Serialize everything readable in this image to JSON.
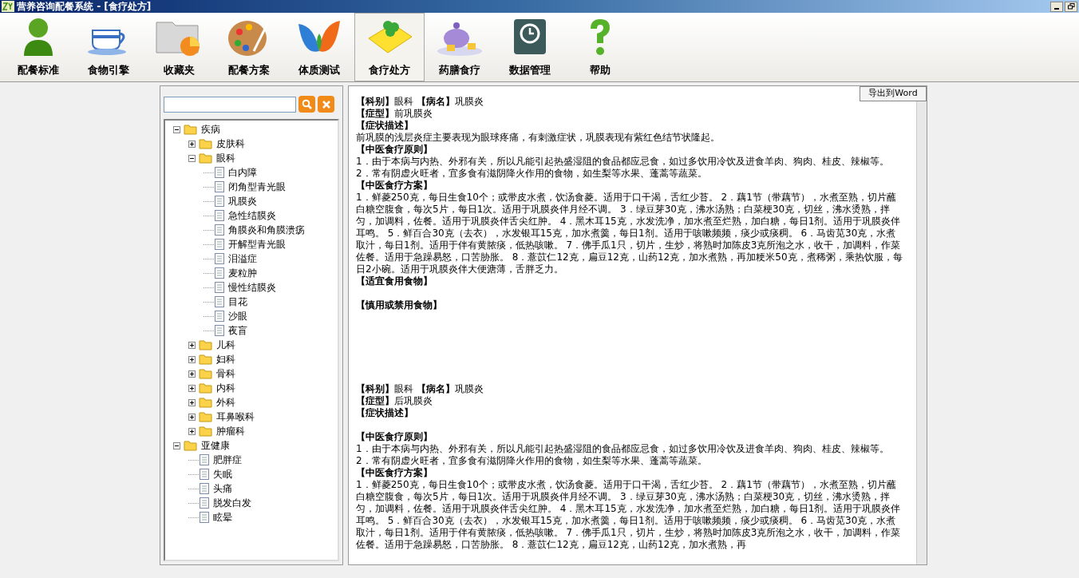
{
  "window": {
    "title": "营养咨询配餐系统 - [食疗处方]"
  },
  "toolbar": [
    {
      "label": "配餐标准",
      "selected": false
    },
    {
      "label": "食物引擎",
      "selected": false
    },
    {
      "label": "收藏夹",
      "selected": false
    },
    {
      "label": "配餐方案",
      "selected": false
    },
    {
      "label": "体质测试",
      "selected": false
    },
    {
      "label": "食疗处方",
      "selected": true
    },
    {
      "label": "药膳食疗",
      "selected": false
    },
    {
      "label": "数据管理",
      "selected": false
    },
    {
      "label": "帮助",
      "selected": false
    }
  ],
  "tree": [
    {
      "label": "疾病",
      "kind": "folder",
      "expanded": true,
      "children": [
        {
          "label": "皮肤科",
          "kind": "folder",
          "expanded": false
        },
        {
          "label": "眼科",
          "kind": "folder",
          "expanded": true,
          "children": [
            {
              "label": "白内障",
              "kind": "doc"
            },
            {
              "label": "闭角型青光眼",
              "kind": "doc"
            },
            {
              "label": "巩膜炎",
              "kind": "doc"
            },
            {
              "label": "急性结膜炎",
              "kind": "doc"
            },
            {
              "label": "角膜炎和角膜溃疡",
              "kind": "doc"
            },
            {
              "label": "开解型青光眼",
              "kind": "doc"
            },
            {
              "label": "泪溢症",
              "kind": "doc"
            },
            {
              "label": "麦粒肿",
              "kind": "doc"
            },
            {
              "label": "慢性结膜炎",
              "kind": "doc"
            },
            {
              "label": "目花",
              "kind": "doc"
            },
            {
              "label": "沙眼",
              "kind": "doc"
            },
            {
              "label": "夜盲",
              "kind": "doc"
            }
          ]
        },
        {
          "label": "儿科",
          "kind": "folder",
          "expanded": false
        },
        {
          "label": "妇科",
          "kind": "folder",
          "expanded": false
        },
        {
          "label": "骨科",
          "kind": "folder",
          "expanded": false
        },
        {
          "label": "内科",
          "kind": "folder",
          "expanded": false
        },
        {
          "label": "外科",
          "kind": "folder",
          "expanded": false
        },
        {
          "label": "耳鼻喉科",
          "kind": "folder",
          "expanded": false
        },
        {
          "label": "肿瘤科",
          "kind": "folder",
          "expanded": false
        }
      ]
    },
    {
      "label": "亚健康",
      "kind": "folder",
      "expanded": true,
      "children": [
        {
          "label": "肥胖症",
          "kind": "doc"
        },
        {
          "label": "失眠",
          "kind": "doc"
        },
        {
          "label": "头痛",
          "kind": "doc"
        },
        {
          "label": "脱发白发",
          "kind": "doc"
        },
        {
          "label": "眩晕",
          "kind": "doc"
        }
      ]
    }
  ],
  "export_button": "导出到Word",
  "document": [
    {
      "kind": "mixed",
      "text": "**【科别】**眼科 **【病名】**巩膜炎"
    },
    {
      "kind": "mixed",
      "text": "**【症型】**前巩膜炎"
    },
    {
      "kind": "heading",
      "text": "【症状描述】"
    },
    {
      "kind": "text",
      "text": "前巩膜的浅层炎症主要表现为眼球疼痛，有刺激症状，巩膜表现有紫红色结节状隆起。"
    },
    {
      "kind": "heading",
      "text": "【中医食疗原则】"
    },
    {
      "kind": "text",
      "text": "1．由于本病与内热、外邪有关，所以凡能引起热盛湿阻的食品都应忌食，如过多饮用冷饮及进食羊肉、狗肉、桂皮、辣椒等。 2．常有阴虚火旺者，宜多食有滋阴降火作用的食物，如生梨等水果、蓬蒿等蔬菜。"
    },
    {
      "kind": "heading",
      "text": "【中医食疗方案】"
    },
    {
      "kind": "text",
      "text": "1．鲜菱250克，每日生食10个；或带皮水煮，饮汤食菱。适用于口干渴，舌红少苔。 2．藕1节（带藕节），水煮至熟，切片蘸白糖空腹食，每次5片，每日1次。适用于巩膜炎伴月经不调。 3．绿豆芽30克，沸水汤熟；白菜梗30克，切丝，沸水烫熟，拌匀，加调料，佐餐。适用于巩膜炎伴舌尖红肿。 4．黑木耳15克，水发洗净，加水煮至烂熟，加白糖，每日1剂。适用于巩膜炎伴耳鸣。 5．鲜百合30克（去衣），水发银耳15克，加水煮羹，每日1剂。适用于咳嗽频频，痰少或痰稠。 6．马齿苋30克，水煮取汁，每日1剂。适用于伴有黄脓痰，低热咳嗽。 7．佛手瓜1只，切片，生炒，将熟时加陈皮3克所泡之水，收干，加调料，作菜佐餐。适用于急躁易怒，口苦胁胀。 8．薏苡仁12克，扁豆12克，山药12克，加水煮熟，再加粳米50克，煮稀粥，乘热饮服，每日2小碗。适用于巩膜炎伴大便溏薄，舌胖乏力。"
    },
    {
      "kind": "heading",
      "text": "【适宜食用食物】"
    },
    {
      "kind": "blank"
    },
    {
      "kind": "heading",
      "text": "【慎用或禁用食物】"
    },
    {
      "kind": "blank"
    },
    {
      "kind": "blank"
    },
    {
      "kind": "blank"
    },
    {
      "kind": "blank"
    },
    {
      "kind": "blank"
    },
    {
      "kind": "blank"
    },
    {
      "kind": "mixed",
      "text": "**【科别】**眼科 **【病名】**巩膜炎"
    },
    {
      "kind": "mixed",
      "text": "**【症型】**后巩膜炎"
    },
    {
      "kind": "heading",
      "text": "【症状描述】"
    },
    {
      "kind": "blank"
    },
    {
      "kind": "heading",
      "text": "【中医食疗原则】"
    },
    {
      "kind": "text",
      "text": "1．由于本病与内热、外邪有关，所以凡能引起热盛湿阻的食品都应忌食，如过多饮用冷饮及进食羊肉、狗肉、桂皮、辣椒等。 2．常有阴虚火旺者，宜多食有滋阴降火作用的食物，如生梨等水果、蓬蒿等蔬菜。"
    },
    {
      "kind": "heading",
      "text": "【中医食疗方案】"
    },
    {
      "kind": "text",
      "text": "1．鲜菱250克，每日生食10个；或带皮水煮，饮汤食菱。适用于口干渴，舌红少苔。 2．藕1节（带藕节），水煮至熟，切片蘸白糖空腹食，每次5片，每日1次。适用于巩膜炎伴月经不调。 3．绿豆芽30克，沸水汤熟；白菜梗30克，切丝，沸水烫熟，拌匀，加调料，佐餐。适用于巩膜炎伴舌尖红肿。 4．黑木耳15克，水发洗净，加水煮至烂熟，加白糖，每日1剂。适用于巩膜炎伴耳鸣。 5．鲜百合30克（去衣），水发银耳15克，加水煮羹，每日1剂。适用于咳嗽频频，痰少或痰稠。 6．马齿苋30克，水煮取汁，每日1剂。适用于伴有黄脓痰，低热咳嗽。 7．佛手瓜1只，切片，生炒，将熟时加陈皮3克所泡之水，收干，加调料，作菜佐餐。适用于急躁易怒，口苦胁胀。 8．薏苡仁12克，扁豆12克，山药12克，加水煮熟，再"
    }
  ]
}
